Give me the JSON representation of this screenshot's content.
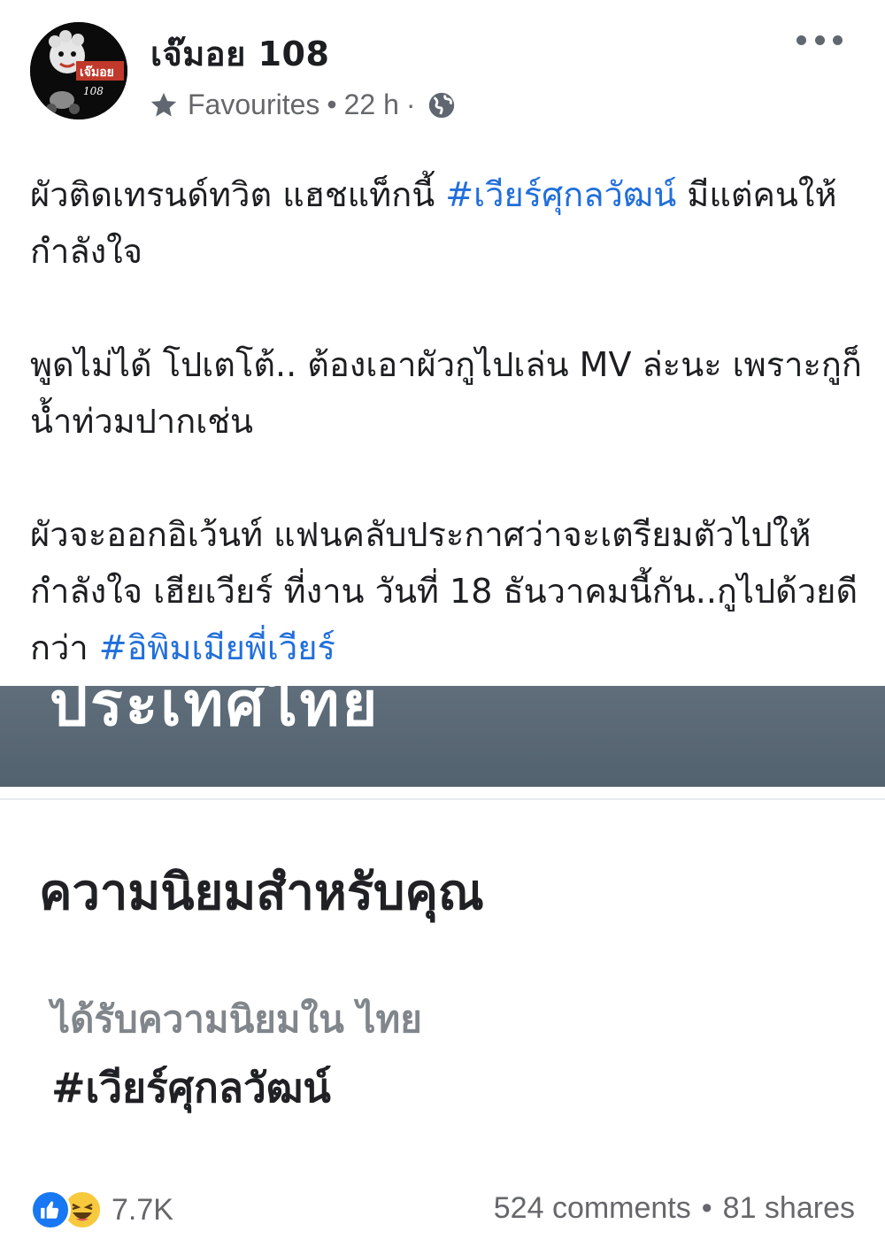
{
  "post": {
    "author": "เจ๊มอย 108",
    "audience": "Favourites",
    "dot": "•",
    "time": "22 h",
    "dot2": "·",
    "avatar_text": "เจ๊มอย",
    "avatar_sub": "108"
  },
  "body": {
    "p1_text": "ผัวติดเทรนด์ทวิต แฮชแท็กนี้ ",
    "p1_hashtag": "#เวียร์ศุกลวัฒน์",
    "p1_rest": " มีแต่คนให้กำลังใจ",
    "p2": "พูดไม่ได้ โปเตโต้.. ต้องเอาผัวกูไปเล่น MV ล่ะนะ เพราะกูก็น้ำท่วมปากเช่น",
    "p3_text": "ผัวจะออกอิเว้นท์ แฟนคลับประกาศว่าจะเตรียมตัวไปให้กำลังใจ เฮียเวียร์ ที่งาน วันที่ 18 ธันวาคมนี้กัน..กูไปด้วยดีกว่า ",
    "p3_hashtag": "#อิพิมเมียพี่เวียร์"
  },
  "image": {
    "banner_text": "ประเทศไทย",
    "popular_title": "ความนิยมสำหรับคุณ",
    "trend_subtitle": "ได้รับความนิยมใน ไทย",
    "trend_tag": "#เวียร์ศุกลวัฒน์"
  },
  "footer": {
    "reaction_count": "7.7K",
    "comments": "524 comments",
    "sep": "•",
    "shares": "81 shares"
  },
  "colors": {
    "link": "#216fdb",
    "meta": "#65676b",
    "like": "#1877f2",
    "haha": "#f7c93c"
  },
  "icons": [
    "star-icon",
    "globe-icon",
    "more-options-icon",
    "like-reaction-icon",
    "haha-reaction-icon"
  ]
}
